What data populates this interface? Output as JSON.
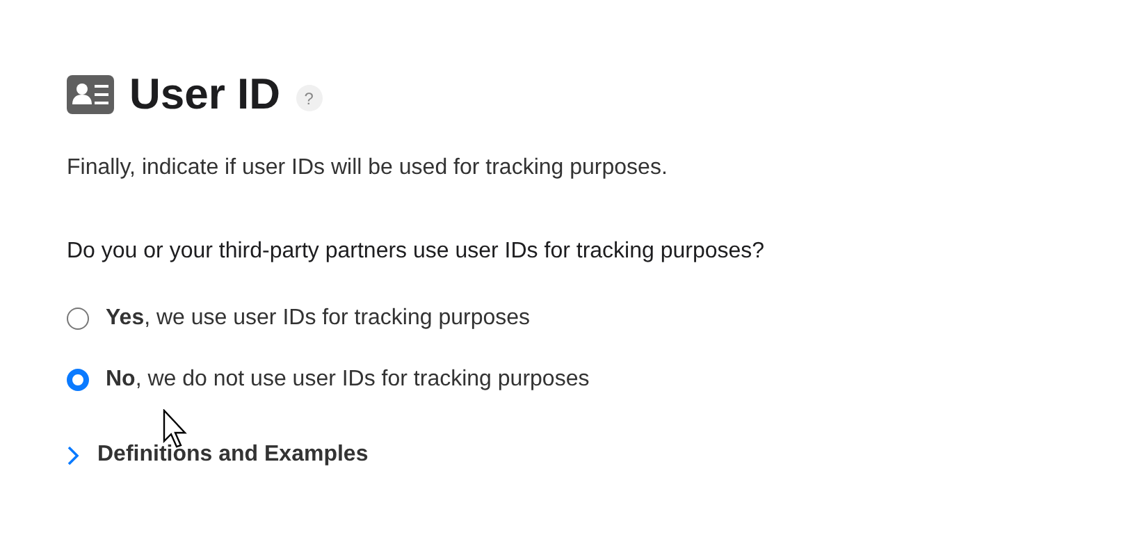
{
  "header": {
    "title": "User ID",
    "help": "?"
  },
  "intro": "Finally, indicate if user IDs will be used for tracking purposes.",
  "question": "Do you or your third-party partners use user IDs for tracking purposes?",
  "options": [
    {
      "label": "**Yes**, we use user IDs for tracking purposes",
      "selected": false
    },
    {
      "label": "**No**, we do not use user IDs for tracking purposes",
      "selected": true
    }
  ],
  "disclosure": {
    "label": "Definitions and Examples",
    "expanded": false
  }
}
